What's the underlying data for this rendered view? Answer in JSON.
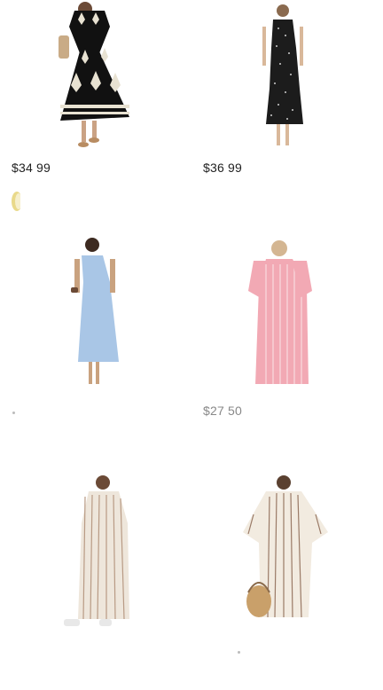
{
  "products": [
    {
      "name": "black-embroidered-maxi-dress",
      "price": "$34 99",
      "colors": {
        "dress": "#111111",
        "pattern": "#e8e2d2"
      }
    },
    {
      "name": "black-polka-dot-mermaid-dress",
      "price": "$36 99",
      "colors": {
        "dress": "#1c1c1c",
        "pattern": "#cfcfcf"
      }
    },
    {
      "name": "blue-sleeveless-maxi-dress",
      "price": "",
      "colors": {
        "dress": "#a9c6e6"
      }
    },
    {
      "name": "pink-striped-shirt-dress",
      "price": "$27 50",
      "colors": {
        "dress": "#f2a9b4",
        "pattern": "#ffffff"
      }
    },
    {
      "name": "beige-striped-shirt-dress",
      "price": "",
      "colors": {
        "dress": "#eee6db",
        "pattern": "#b89a84"
      }
    },
    {
      "name": "beige-striped-kaftan-dress",
      "price": "",
      "colors": {
        "dress": "#f2ebe0",
        "pattern": "#9a7a66"
      }
    }
  ]
}
